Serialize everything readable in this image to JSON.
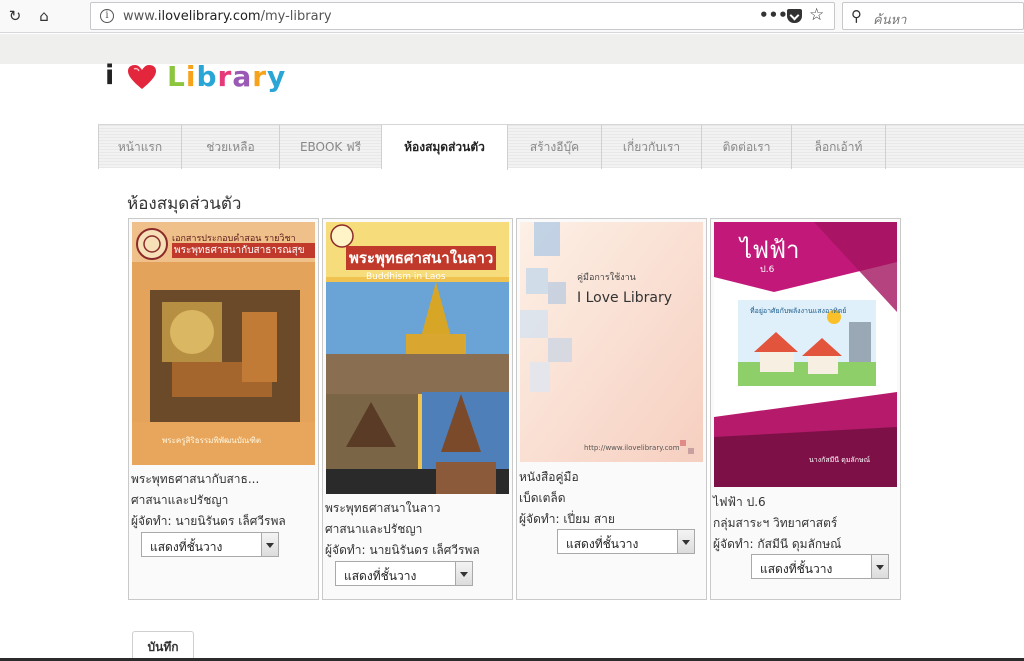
{
  "browser": {
    "url_prefix": "www.",
    "url_host": "ilovelibrary.com",
    "url_path": "/my-library",
    "more_label": "•••",
    "search_placeholder": "ค้นหา"
  },
  "logo": {
    "i": "i",
    "word": "Library"
  },
  "tabs": [
    {
      "label": "หน้าแรก",
      "active": false
    },
    {
      "label": "ช่วยเหลือ",
      "active": false
    },
    {
      "label": "EBOOK ฟรี",
      "active": false
    },
    {
      "label": "ห้องสมุดส่วนตัว",
      "active": true
    },
    {
      "label": "สร้างอีบุ๊ค",
      "active": false
    },
    {
      "label": "เกี่ยวกับเรา",
      "active": false
    },
    {
      "label": "ติดต่อเรา",
      "active": false
    },
    {
      "label": "ล็อกเอ้าท์",
      "active": false
    }
  ],
  "section_title": "ห้องสมุดส่วนตัว",
  "books": [
    {
      "title": "พระพุทธศาสนากับสาธ...",
      "category": "ศาสนาและปรัชญา",
      "author": "ผู้จัดทำ: นายนิรันดร เล็ศวีรพล",
      "shelf": "แสดงที่ชั้นวาง",
      "cover": {
        "top_text": "เอกสารประกอบคำสอน รายวิชา",
        "title": "พระพุทธศาสนากับสาธารณสุข",
        "bottom_text": "พระครูสิริธรรมพิพัฒนบัณฑิต"
      }
    },
    {
      "title": "พระพุทธศาสนาในลาว",
      "category": "ศาสนาและปรัชญา",
      "author": "ผู้จัดทำ: นายนิรันดร เล็ศวีรพล",
      "shelf": "แสดงที่ชั้นวาง",
      "cover": {
        "title": "พระพุทธศาสนาในลาว",
        "subtitle": "Buddhism in Laos"
      }
    },
    {
      "title": "หนังสือคู่มือ",
      "category": "เบ็ดเตล็ด",
      "author": "ผู้จัดทำ: เปี่ยม สาย",
      "shelf": "แสดงที่ชั้นวาง",
      "cover": {
        "small": "คู่มือการใช้งาน",
        "title": "I Love Library",
        "url": "http://www.ilovelibrary.com"
      }
    },
    {
      "title": "ไฟฟ้า ป.6",
      "category": "กลุ่มสาระฯ วิทยาศาสตร์",
      "author": "ผู้จัดทำ: กัสมีนี ดุมลักษณ์",
      "shelf": "แสดงที่ชั้นวาง",
      "cover": {
        "title": "ไฟฟ้า",
        "grade": "ป.6",
        "caption": "ที่อยู่อาศัยกับพลังงานแสงอาทิตย์",
        "footer": "นางกัสมีนี ดุมลักษณ์"
      }
    }
  ],
  "save_label": "บันทึก",
  "colors": {
    "active_tab_text": "#222222",
    "inactive_tab_text": "#888888",
    "heart": "#e3263b"
  }
}
